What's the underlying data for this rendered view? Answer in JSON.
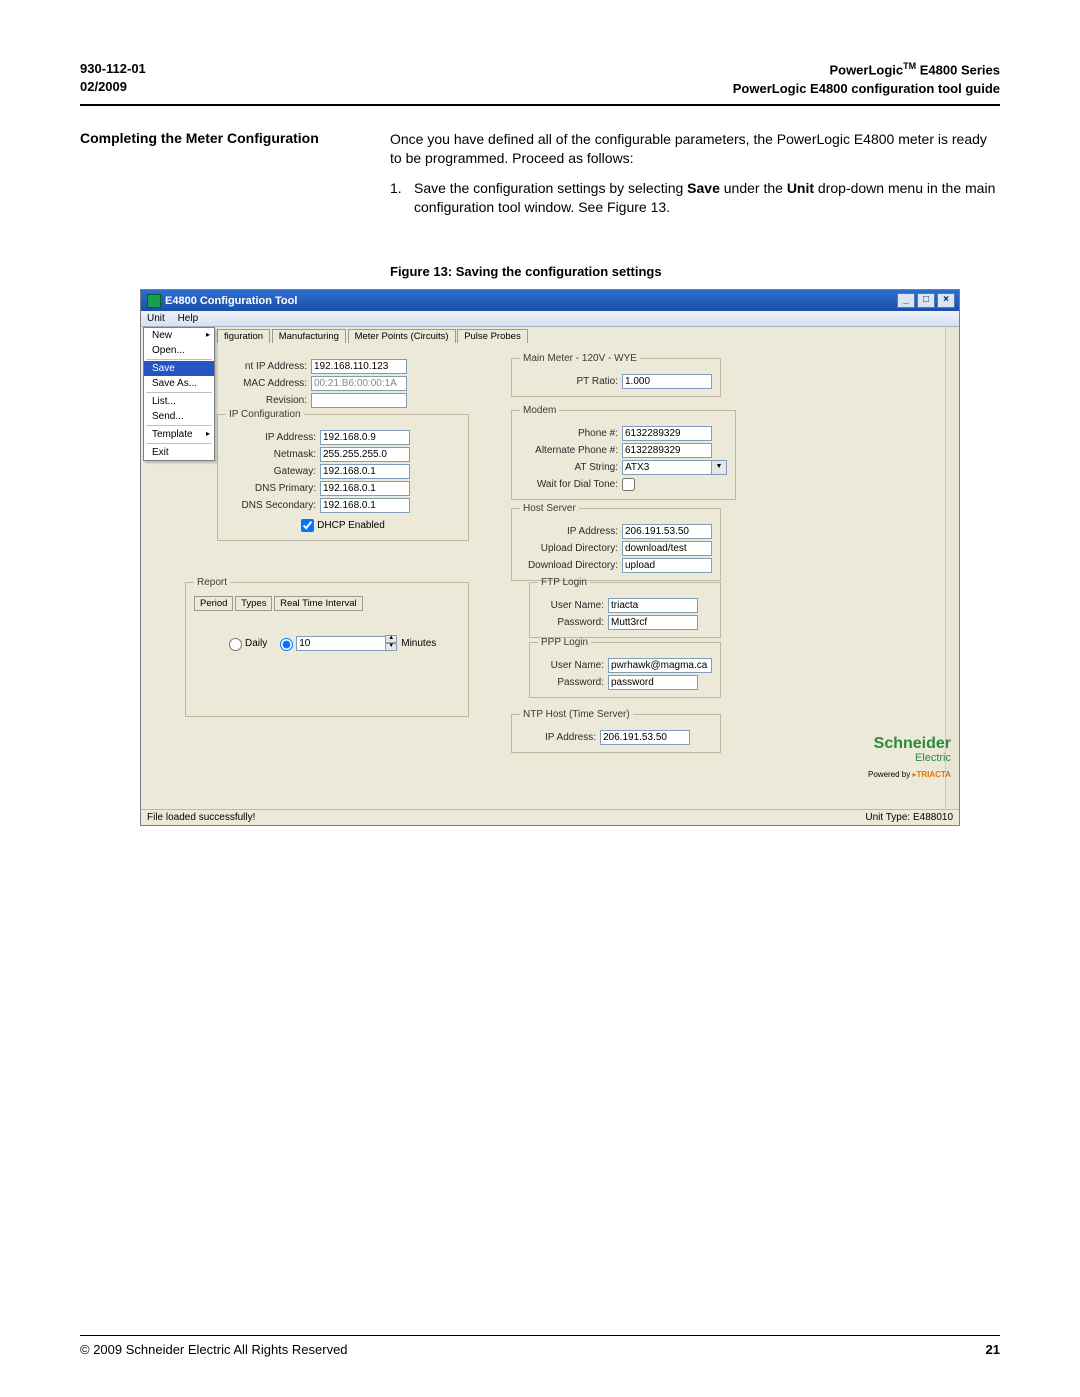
{
  "header": {
    "doc_num": "930-112-01",
    "date": "02/2009",
    "product_series": "PowerLogic",
    "product_series_tm": "TM",
    "product_series_suffix": " E4800 Series",
    "guide_title": "PowerLogic E4800 configuration tool guide"
  },
  "section": {
    "heading": "Completing the Meter Configuration",
    "intro": "Once you have defined all of the configurable parameters, the PowerLogic E4800 meter is ready to be programmed. Proceed as follows:",
    "step_num": "1.",
    "step_a": "Save the configuration settings by selecting ",
    "step_save": "Save",
    "step_b": " under the ",
    "step_unit": "Unit",
    "step_c": " drop-down menu in the main configuration tool window. See Figure 13."
  },
  "figure_caption": "Figure 13:  Saving the configuration settings",
  "window": {
    "title": "E4800 Configuration Tool",
    "btn_min": "_",
    "btn_max": "□",
    "btn_close": "×",
    "menubar": {
      "unit": "Unit",
      "help": "Help"
    },
    "dropdown": {
      "new": "New",
      "open": "Open...",
      "save": "Save",
      "save_as": "Save As...",
      "list": "List...",
      "send": "Send...",
      "template": "Template",
      "exit": "Exit"
    },
    "tabs": {
      "t1": "figuration",
      "t2": "Manufacturing",
      "t3": "Meter Points (Circuits)",
      "t4": "Pulse Probes"
    },
    "ident": {
      "ip_label": "nt IP Address:",
      "ip": "192.168.110.123",
      "mac_label": "MAC Address:",
      "mac": "00:21:B6:00:00:1A",
      "rev_label": "Revision:",
      "rev": ""
    },
    "ipconf": {
      "legend": "IP Configuration",
      "ip_label": "IP Address:",
      "ip": "192.168.0.9",
      "netmask_label": "Netmask:",
      "netmask": "255.255.255.0",
      "gateway_label": "Gateway:",
      "gateway": "192.168.0.1",
      "dns1_label": "DNS Primary:",
      "dns1": "192.168.0.1",
      "dns2_label": "DNS Secondary:",
      "dns2": "192.168.0.1",
      "dhcp_label": "DHCP Enabled"
    },
    "report": {
      "legend": "Report",
      "tab_period": "Period",
      "tab_types": "Types",
      "tab_rti": "Real Time Interval",
      "daily_label": "Daily",
      "minutes_value": "10",
      "minutes_label": "Minutes"
    },
    "mainmeter": {
      "legend": "Main Meter - 120V - WYE",
      "pt_label": "PT Ratio:",
      "pt": "1.000"
    },
    "modem": {
      "legend": "Modem",
      "phone_label": "Phone #:",
      "phone": "6132289329",
      "alt_label": "Alternate Phone #:",
      "alt": "6132289329",
      "at_label": "AT String:",
      "at": "ATX3",
      "dial_label": "Wait for Dial Tone:"
    },
    "host": {
      "legend": "Host Server",
      "ip_label": "IP Address:",
      "ip": "206.191.53.50",
      "upload_label": "Upload Directory:",
      "upload": "download/test",
      "download_label": "Download Directory:",
      "download": "upload"
    },
    "ftp": {
      "legend": "FTP Login",
      "user_label": "User Name:",
      "user": "triacta",
      "pass_label": "Password:",
      "pass": "Mutt3rcf"
    },
    "ppp": {
      "legend": "PPP Login",
      "user_label": "User Name:",
      "user": "pwrhawk@magma.ca",
      "pass_label": "Password:",
      "pass": "password"
    },
    "ntp": {
      "legend": "NTP Host (Time Server)",
      "ip_label": "IP Address:",
      "ip": "206.191.53.50"
    },
    "brand": {
      "schneider": "Schneider",
      "electric": "Electric",
      "powered": "Powered by ",
      "triacta": "TRIACTA"
    },
    "status": {
      "left": "File loaded successfully!",
      "right": "Unit Type: E488010"
    }
  },
  "footer": {
    "copyright": "© 2009 Schneider Electric All Rights Reserved",
    "pagenum": "21"
  }
}
